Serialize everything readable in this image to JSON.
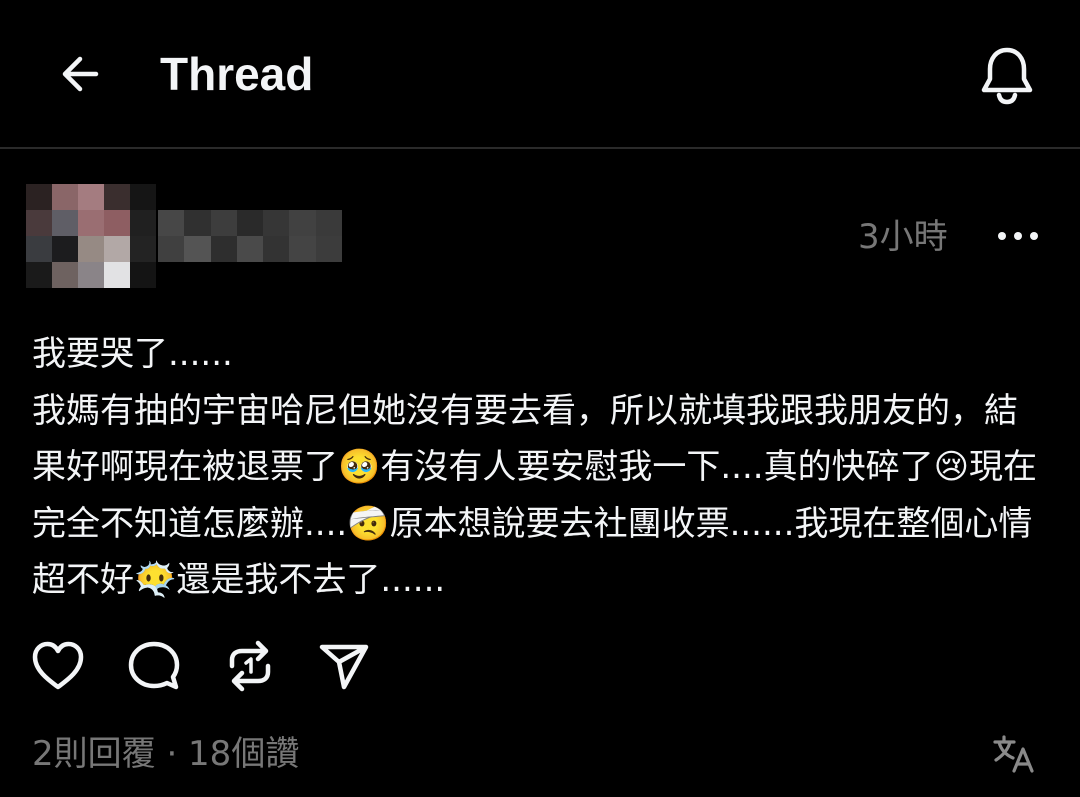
{
  "header": {
    "title": "Thread",
    "back_icon": "arrow-left-icon",
    "notify_icon": "bell-icon"
  },
  "post": {
    "time": "3小時",
    "more_icon": "more-horizontal-icon",
    "text": "我要哭了......\n我媽有抽的宇宙哈尼但她沒有要去看，所以就填我跟我朋友的，結果好啊現在被退票了🥹有沒有人要安慰我一下....真的快碎了😢現在完全不知道怎麼辦....🤕原本想說要去社團收票......我現在整個心情超不好😶‍🌫️還是我不去了......",
    "avatar_colors": [
      "#2b2222",
      "#8a6668",
      "#a47c80",
      "#3a2e2e",
      "#151515",
      "#4a3a3c",
      "#5f5e66",
      "#9a6e72",
      "#8e5e62",
      "#202020",
      "#3a3c40",
      "#1c1c1e",
      "#968a84",
      "#b2a8a6",
      "#232323",
      "#1a1a1a",
      "#6e6260",
      "#8a8488",
      "#e2e2e4",
      "#141414"
    ],
    "username_colors": [
      "#474747",
      "#303030",
      "#3d3d3d",
      "#2a2a2a",
      "#363636",
      "#414141",
      "#3a3a3a",
      "#404040",
      "#545454",
      "#2e2e2e",
      "#4a4a4a",
      "#333333",
      "#444444",
      "#3c3c3c"
    ]
  },
  "actions": [
    {
      "name": "like-button",
      "icon": "heart-icon"
    },
    {
      "name": "reply-button",
      "icon": "comment-icon"
    },
    {
      "name": "repost-button",
      "icon": "repost-icon"
    },
    {
      "name": "share-button",
      "icon": "send-icon"
    }
  ],
  "footer": {
    "stats": "2則回覆 · 18個讚",
    "translate_icon": "translate-icon"
  },
  "colors": {
    "background": "#000000",
    "text": "#f3f5f7",
    "muted": "#777777",
    "divider": "#2a2a2a"
  }
}
